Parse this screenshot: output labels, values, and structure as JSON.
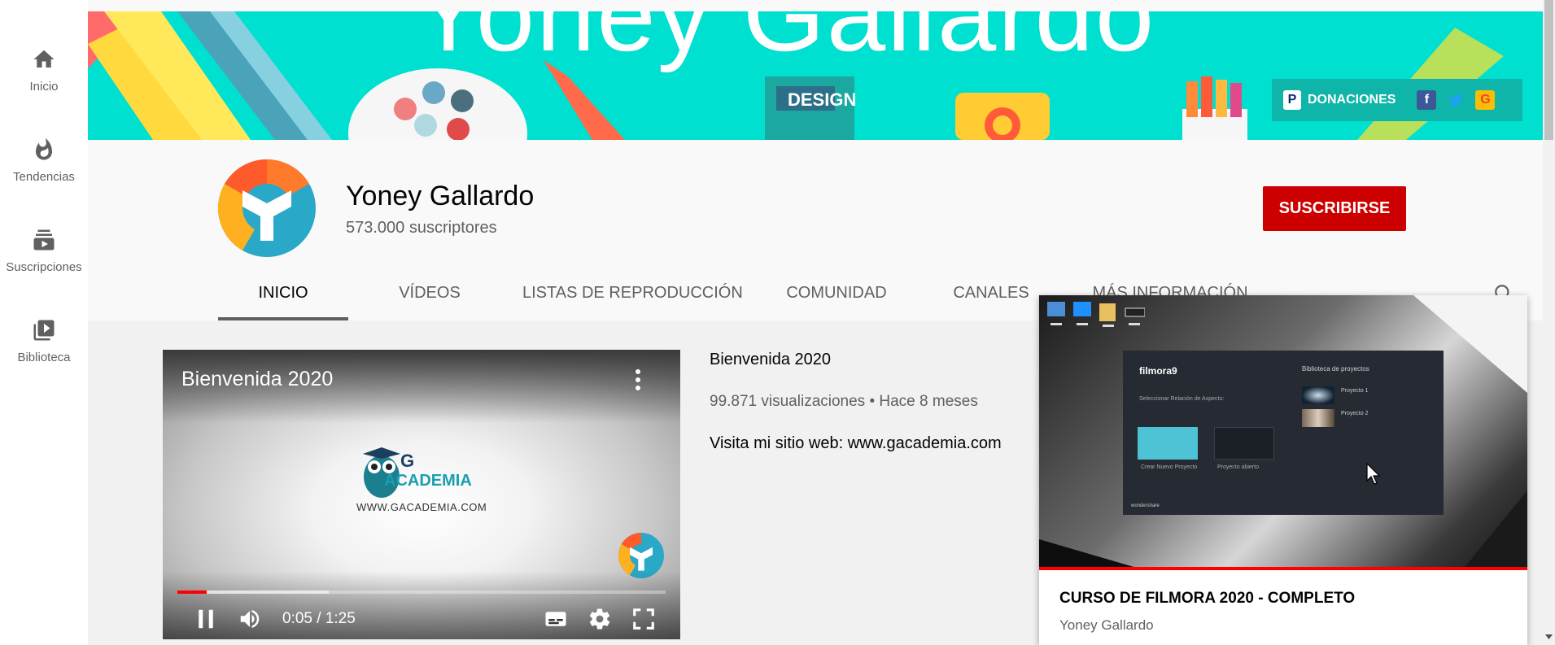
{
  "nav": {
    "items": [
      {
        "label": "Inicio",
        "icon": "home-icon"
      },
      {
        "label": "Tendencias",
        "icon": "fire-icon"
      },
      {
        "label": "Suscripciones",
        "icon": "subscriptions-icon"
      },
      {
        "label": "Biblioteca",
        "icon": "library-icon"
      }
    ]
  },
  "banner": {
    "title": "Yoney Gallardo",
    "design_label": "DESIGN",
    "links_label": "DONACIONES",
    "paypal_glyph": "P",
    "facebook_glyph": "f",
    "google_glyph": "G"
  },
  "channel": {
    "name": "Yoney Gallardo",
    "subscribers": "573.000 suscriptores",
    "subscribe_label": "SUSCRIBIRSE",
    "subscribe_color": "#cc0000"
  },
  "tabs": [
    {
      "label": "INICIO",
      "active": true
    },
    {
      "label": "VÍDEOS",
      "active": false
    },
    {
      "label": "LISTAS DE REPRODUCCIÓN",
      "active": false
    },
    {
      "label": "COMUNIDAD",
      "active": false
    },
    {
      "label": "CANALES",
      "active": false
    },
    {
      "label": "MÁS INFORMACIÓN",
      "active": false
    }
  ],
  "featured": {
    "player_title": "Bienvenida 2020",
    "logo_letters": "G",
    "logo_word": "ACADEMIA",
    "logo_url_text": "WWW.GACADEMIA.COM",
    "time": "0:05 / 1:25",
    "played_fraction": 0.06,
    "buffered_fraction": 0.31,
    "title": "Bienvenida 2020",
    "meta": "99.871 visualizaciones • Hace 8 meses",
    "description": "Visita mi sitio web: www.gacademia.com"
  },
  "hover_card": {
    "title": "CURSO DE FILMORA 2020 - COMPLETO",
    "channel": "Yoney Gallardo",
    "preview": {
      "app_name": "filmora9",
      "new_project": "Crear Nuevo Proyecto",
      "open_project": "Proyecto abierto",
      "library": "Biblioteca de proyectos",
      "aspect_label": "Seleccionar Relación de Aspecto:",
      "project1": "Proyecto 1",
      "project2": "Proyecto 2",
      "brand": "wondershare"
    }
  },
  "colors": {
    "banner_bg": "#00e0d0",
    "accent_red": "#ff0000"
  }
}
